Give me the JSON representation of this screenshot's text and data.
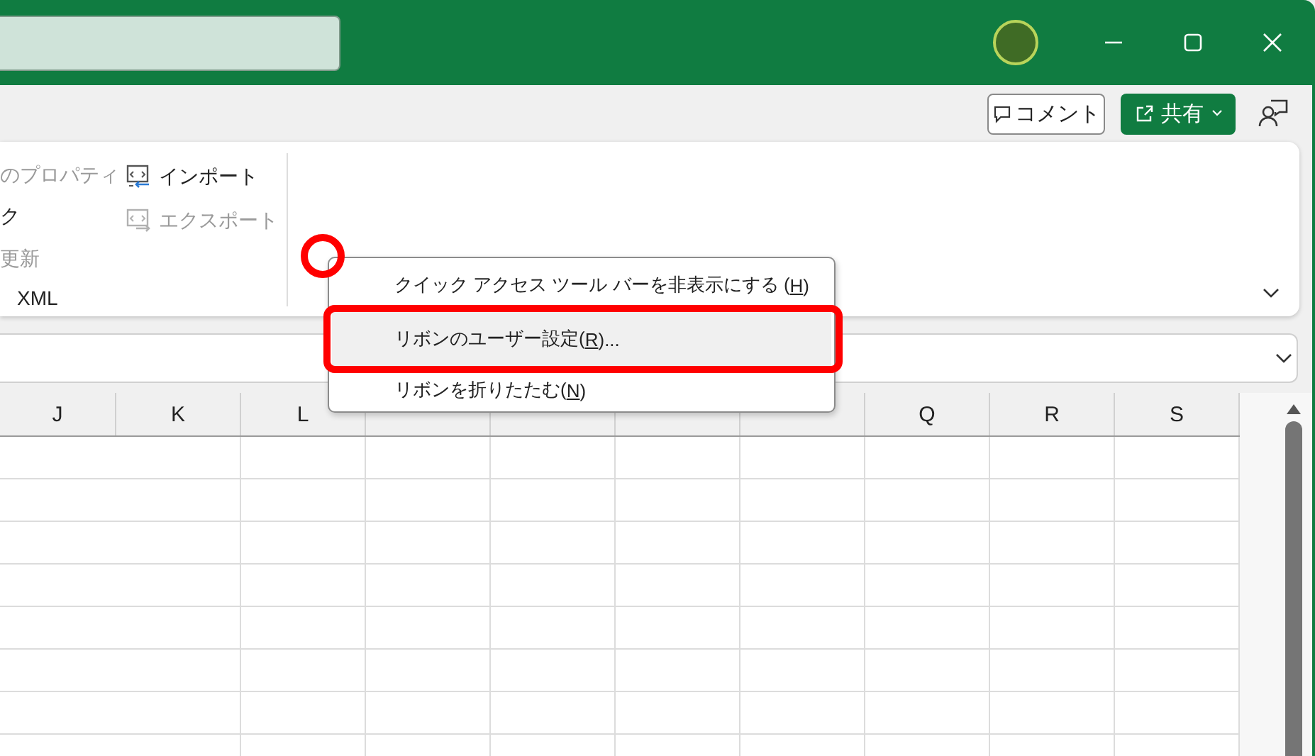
{
  "command_bar": {
    "comment_button": "コメント",
    "share_button": "共有"
  },
  "ribbon": {
    "columns": [
      {
        "items": [
          {
            "label": "のプロパティ",
            "disabled": true
          },
          {
            "label": "ク",
            "disabled": false
          },
          {
            "label": "更新",
            "disabled": true
          },
          {
            "label": "XML",
            "disabled": false
          }
        ]
      },
      {
        "items": [
          {
            "label": "インポート",
            "disabled": false,
            "kind": "import"
          },
          {
            "label": "エクスポート",
            "disabled": true,
            "kind": "export"
          }
        ]
      }
    ]
  },
  "sheet": {
    "columns_left": [
      "J",
      "K",
      "L"
    ],
    "columns_right": [
      "Q",
      "R",
      "S"
    ]
  },
  "context_menu": {
    "items": [
      {
        "prefix": "クイック アクセス ツール バーを非表示にする (",
        "key": "H",
        "suffix": ")",
        "selected": false
      },
      {
        "prefix": "リボンのユーザー設定(",
        "key": "R",
        "suffix": ")...",
        "selected": true
      },
      {
        "prefix": "リボンを折りたたむ(",
        "key": "N",
        "suffix": ")",
        "selected": false
      }
    ]
  }
}
